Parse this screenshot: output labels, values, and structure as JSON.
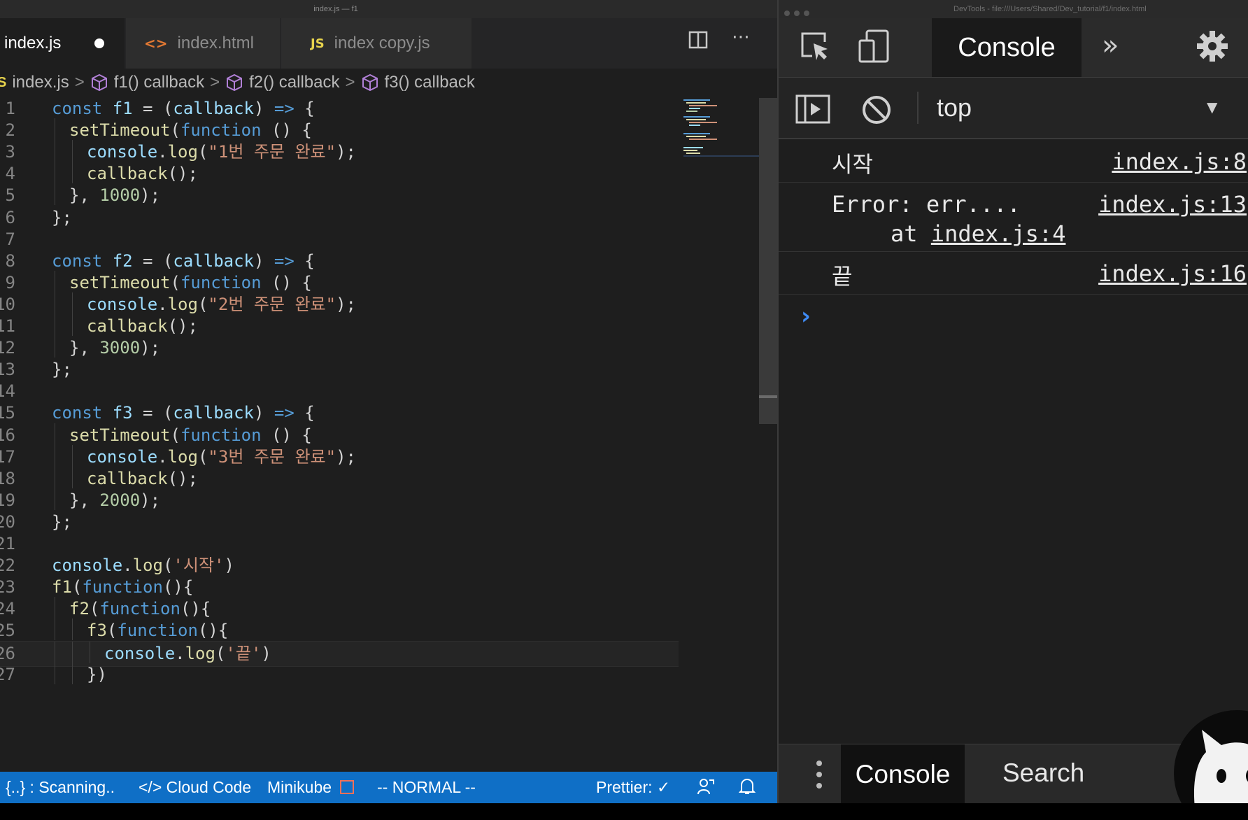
{
  "editor": {
    "window_title": "index.js — f1",
    "tabs": [
      {
        "label": "index.js",
        "icon": "js-file-icon",
        "modified": true,
        "active": true
      },
      {
        "label": "index.html",
        "icon_text": "<>",
        "active": false
      },
      {
        "label": "index copy.js",
        "icon_text": "JS",
        "active": false
      }
    ],
    "breadcrumb": {
      "file": "index.js",
      "items": [
        "f1() callback",
        "f2() callback",
        "f3() callback"
      ]
    },
    "code_lines": [
      {
        "n": "1",
        "indent": 0,
        "t": [
          [
            "kw",
            "const"
          ],
          [
            "pn",
            " "
          ],
          [
            "id",
            "f1"
          ],
          [
            "pn",
            " = ("
          ],
          [
            "id",
            "callback"
          ],
          [
            "pn",
            ") "
          ],
          [
            "kw",
            "=>"
          ],
          [
            "pn",
            " {"
          ]
        ]
      },
      {
        "n": "2",
        "indent": 1,
        "t": [
          [
            "fn",
            "setTimeout"
          ],
          [
            "pn",
            "("
          ],
          [
            "kw",
            "function"
          ],
          [
            "pn",
            " () {"
          ]
        ]
      },
      {
        "n": "3",
        "indent": 2,
        "t": [
          [
            "id",
            "console"
          ],
          [
            "pn",
            "."
          ],
          [
            "fn",
            "log"
          ],
          [
            "pn",
            "("
          ],
          [
            "st",
            "\"1번 주문 완료\""
          ],
          [
            "pn",
            ");"
          ]
        ]
      },
      {
        "n": "4",
        "indent": 2,
        "t": [
          [
            "fn",
            "callback"
          ],
          [
            "pn",
            "();"
          ]
        ]
      },
      {
        "n": "5",
        "indent": 1,
        "t": [
          [
            "pn",
            "}, "
          ],
          [
            "nm",
            "1000"
          ],
          [
            "pn",
            ");"
          ]
        ]
      },
      {
        "n": "6",
        "indent": 0,
        "t": [
          [
            "pn",
            "};"
          ]
        ]
      },
      {
        "n": "7",
        "indent": 0,
        "t": []
      },
      {
        "n": "8",
        "indent": 0,
        "t": [
          [
            "kw",
            "const"
          ],
          [
            "pn",
            " "
          ],
          [
            "id",
            "f2"
          ],
          [
            "pn",
            " = ("
          ],
          [
            "id",
            "callback"
          ],
          [
            "pn",
            ") "
          ],
          [
            "kw",
            "=>"
          ],
          [
            "pn",
            " {"
          ]
        ]
      },
      {
        "n": "9",
        "indent": 1,
        "t": [
          [
            "fn",
            "setTimeout"
          ],
          [
            "pn",
            "("
          ],
          [
            "kw",
            "function"
          ],
          [
            "pn",
            " () {"
          ]
        ]
      },
      {
        "n": "10",
        "indent": 2,
        "t": [
          [
            "id",
            "console"
          ],
          [
            "pn",
            "."
          ],
          [
            "fn",
            "log"
          ],
          [
            "pn",
            "("
          ],
          [
            "st",
            "\"2번 주문 완료\""
          ],
          [
            "pn",
            ");"
          ]
        ]
      },
      {
        "n": "11",
        "indent": 2,
        "t": [
          [
            "fn",
            "callback"
          ],
          [
            "pn",
            "();"
          ]
        ]
      },
      {
        "n": "12",
        "indent": 1,
        "t": [
          [
            "pn",
            "}, "
          ],
          [
            "nm",
            "3000"
          ],
          [
            "pn",
            ");"
          ]
        ]
      },
      {
        "n": "13",
        "indent": 0,
        "t": [
          [
            "pn",
            "};"
          ]
        ]
      },
      {
        "n": "14",
        "indent": 0,
        "t": []
      },
      {
        "n": "15",
        "indent": 0,
        "t": [
          [
            "kw",
            "const"
          ],
          [
            "pn",
            " "
          ],
          [
            "id",
            "f3"
          ],
          [
            "pn",
            " = ("
          ],
          [
            "id",
            "callback"
          ],
          [
            "pn",
            ") "
          ],
          [
            "kw",
            "=>"
          ],
          [
            "pn",
            " {"
          ]
        ]
      },
      {
        "n": "16",
        "indent": 1,
        "t": [
          [
            "fn",
            "setTimeout"
          ],
          [
            "pn",
            "("
          ],
          [
            "kw",
            "function"
          ],
          [
            "pn",
            " () {"
          ]
        ]
      },
      {
        "n": "17",
        "indent": 2,
        "t": [
          [
            "id",
            "console"
          ],
          [
            "pn",
            "."
          ],
          [
            "fn",
            "log"
          ],
          [
            "pn",
            "("
          ],
          [
            "st",
            "\"3번 주문 완료\""
          ],
          [
            "pn",
            ");"
          ]
        ]
      },
      {
        "n": "18",
        "indent": 2,
        "t": [
          [
            "fn",
            "callback"
          ],
          [
            "pn",
            "();"
          ]
        ]
      },
      {
        "n": "19",
        "indent": 1,
        "t": [
          [
            "pn",
            "}, "
          ],
          [
            "nm",
            "2000"
          ],
          [
            "pn",
            ");"
          ]
        ]
      },
      {
        "n": "20",
        "indent": 0,
        "t": [
          [
            "pn",
            "};"
          ]
        ]
      },
      {
        "n": "21",
        "indent": 0,
        "t": []
      },
      {
        "n": "22",
        "indent": 0,
        "t": [
          [
            "id",
            "console"
          ],
          [
            "pn",
            "."
          ],
          [
            "fn",
            "log"
          ],
          [
            "pn",
            "("
          ],
          [
            "st",
            "'시작'"
          ],
          [
            "pn",
            ")"
          ]
        ]
      },
      {
        "n": "23",
        "indent": 0,
        "t": [
          [
            "fn",
            "f1"
          ],
          [
            "pn",
            "("
          ],
          [
            "kw",
            "function"
          ],
          [
            "pn",
            "(){"
          ]
        ]
      },
      {
        "n": "24",
        "indent": 1,
        "t": [
          [
            "fn",
            "f2"
          ],
          [
            "pn",
            "("
          ],
          [
            "kw",
            "function"
          ],
          [
            "pn",
            "(){"
          ]
        ]
      },
      {
        "n": "25",
        "indent": 2,
        "t": [
          [
            "fn",
            "f3"
          ],
          [
            "pn",
            "("
          ],
          [
            "kw",
            "function"
          ],
          [
            "pn",
            "(){"
          ]
        ]
      },
      {
        "n": "26",
        "indent": 3,
        "t": [
          [
            "id",
            "console"
          ],
          [
            "pn",
            "."
          ],
          [
            "fn",
            "log"
          ],
          [
            "pn",
            "("
          ],
          [
            "st",
            "'끝'"
          ],
          [
            "pn",
            ")"
          ]
        ]
      },
      {
        "n": "27",
        "indent": 2,
        "t": [
          [
            "pn",
            "})"
          ]
        ]
      }
    ],
    "status": {
      "scanning": "{..} : Scanning..",
      "cloud_code": "</> Cloud Code",
      "minikube": "Minikube",
      "mode": "-- NORMAL --",
      "prettier": "Prettier: ✓"
    }
  },
  "devtools": {
    "window_title": "DevTools - file:///Users/Shared/Dev_tutorial/f1/index.html",
    "tab": "Console",
    "context": "top",
    "messages": [
      {
        "text": "시작",
        "source": "index.js:8"
      },
      {
        "text": "Error: err....",
        "source": "index.js:13",
        "stack_prefix": "at",
        "stack_link": "index.js:4"
      },
      {
        "text": "끝",
        "source": "index.js:16"
      }
    ],
    "drawer": {
      "console": "Console",
      "search": "Search"
    }
  },
  "colors": {
    "editor_bg": "#1e1e1e",
    "keyword": "#569cd6",
    "identifier": "#9cdcfe",
    "function": "#dcdcaa",
    "string": "#ce9178",
    "number": "#b5cea8",
    "statusbar": "#0f6fc6",
    "prompt": "#3f8cf6"
  }
}
